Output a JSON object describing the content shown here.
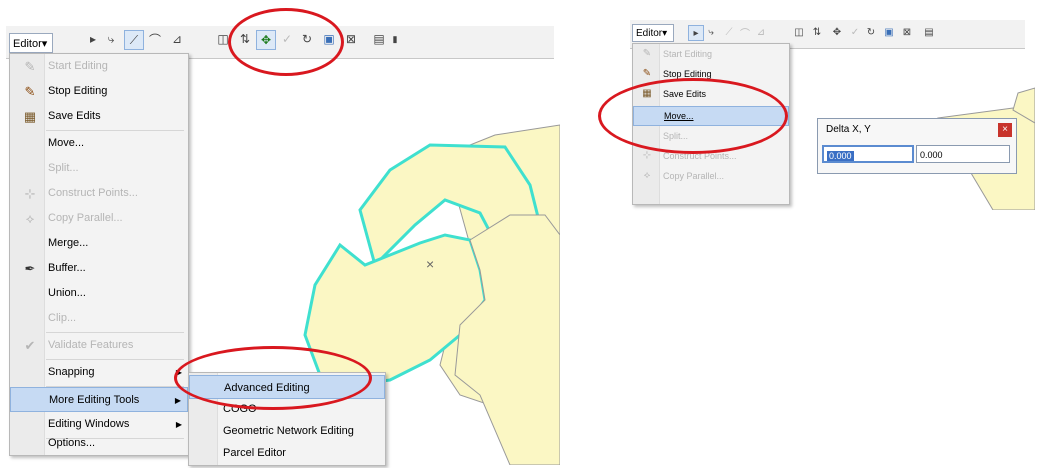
{
  "left": {
    "editor_label": "Editor▾",
    "menu": [
      {
        "label": "Start Editing",
        "icon": "pencil-icon",
        "disabled": true
      },
      {
        "label": "Stop Editing",
        "icon": "stop-edit-icon",
        "disabled": false
      },
      {
        "label": "Save Edits",
        "icon": "save-icon",
        "disabled": false
      },
      {
        "label": "Move...",
        "icon": "",
        "disabled": false
      },
      {
        "label": "Split...",
        "icon": "",
        "disabled": true
      },
      {
        "label": "Construct Points...",
        "icon": "construct-points-icon",
        "disabled": true
      },
      {
        "label": "Copy Parallel...",
        "icon": "copy-parallel-icon",
        "disabled": true
      },
      {
        "label": "Merge...",
        "icon": "",
        "disabled": false
      },
      {
        "label": "Buffer...",
        "icon": "buffer-icon",
        "disabled": false
      },
      {
        "label": "Union...",
        "icon": "",
        "disabled": false
      },
      {
        "label": "Clip...",
        "icon": "",
        "disabled": true
      },
      {
        "label": "Validate Features",
        "icon": "validate-icon",
        "disabled": true
      },
      {
        "label": "Snapping",
        "icon": "",
        "disabled": false,
        "submenu": true
      },
      {
        "label": "More Editing Tools",
        "icon": "",
        "disabled": false,
        "submenu": true,
        "highlighted": true
      },
      {
        "label": "Editing Windows",
        "icon": "",
        "disabled": false,
        "submenu": true
      },
      {
        "label": "Options...",
        "icon": "",
        "disabled": false
      }
    ],
    "submenu": [
      {
        "label": "Advanced Editing",
        "highlighted": true
      },
      {
        "label": "COGO",
        "highlighted": false
      },
      {
        "label": "Geometric Network Editing",
        "highlighted": false
      },
      {
        "label": "Parcel Editor",
        "highlighted": false
      }
    ],
    "map_marker": "×"
  },
  "right": {
    "editor_label": "Editor▾",
    "menu": [
      {
        "label": "Start Editing",
        "icon": "pencil-icon",
        "disabled": true
      },
      {
        "label": "Stop Editing",
        "icon": "stop-edit-icon",
        "disabled": false
      },
      {
        "label": "Save Edits",
        "icon": "save-icon",
        "disabled": false
      },
      {
        "label": "Move...",
        "icon": "",
        "disabled": false,
        "highlighted": true
      },
      {
        "label": "Split...",
        "icon": "",
        "disabled": true
      },
      {
        "label": "Construct Points...",
        "icon": "construct-points-icon",
        "disabled": true
      },
      {
        "label": "Copy Parallel...",
        "icon": "copy-parallel-icon",
        "disabled": true
      }
    ],
    "dialog": {
      "title": "Delta X, Y",
      "close": "×",
      "x_value": "0.000",
      "y_value": "0.000"
    }
  },
  "colors": {
    "highlight": "#c6daf3",
    "circle": "#d9181f",
    "polygon_fill": "#fbf7c4",
    "polygon_selected": "#3fe0cf"
  }
}
